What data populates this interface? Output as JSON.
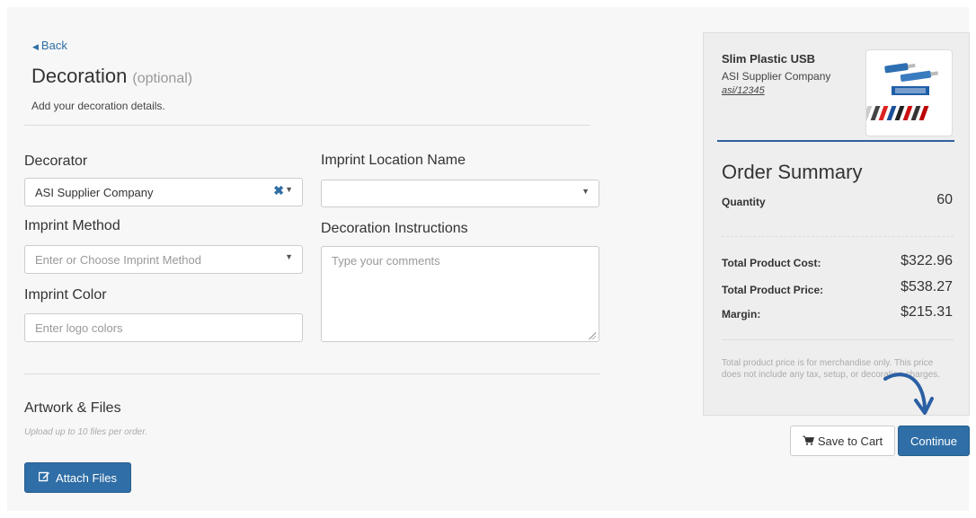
{
  "nav": {
    "back_label": "Back"
  },
  "header": {
    "title": "Decoration",
    "optional": "(optional)",
    "subtitle": "Add your decoration details."
  },
  "form": {
    "decorator": {
      "label": "Decorator",
      "value": "ASI Supplier Company"
    },
    "imprint_location": {
      "label": "Imprint Location Name",
      "value": ""
    },
    "imprint_method": {
      "label": "Imprint Method",
      "placeholder": "Enter or Choose Imprint Method"
    },
    "decoration_instructions": {
      "label": "Decoration Instructions",
      "placeholder": "Type your comments"
    },
    "imprint_color": {
      "label": "Imprint Color",
      "placeholder": "Enter logo colors"
    }
  },
  "artwork": {
    "title": "Artwork & Files",
    "note": "Upload up to 10 files per order.",
    "attach_label": "Attach Files"
  },
  "product": {
    "name": "Slim Plastic USB",
    "supplier": "ASI Supplier Company",
    "id": "asi/12345"
  },
  "summary": {
    "title": "Order Summary",
    "quantity_label": "Quantity",
    "quantity_value": "60",
    "total_cost_label": "Total Product Cost:",
    "total_cost_value": "$322.96",
    "total_price_label": "Total Product Price:",
    "total_price_value": "$538.27",
    "margin_label": "Margin:",
    "margin_value": "$215.31",
    "note": "Total product price is for merchandise only. This price does not include any tax, setup, or decoration charges."
  },
  "actions": {
    "save_to_cart_label": "Save to Cart",
    "continue_label": "Continue"
  },
  "colors": {
    "primary": "#2f6ea6",
    "link": "#2e6da4",
    "summary_bg": "#eeeeee",
    "accent_line": "#2e5fa0"
  },
  "icons": [
    "caret-left-icon",
    "clear-icon",
    "chevron-down-icon",
    "edit-icon",
    "cart-icon",
    "arrow-icon"
  ]
}
